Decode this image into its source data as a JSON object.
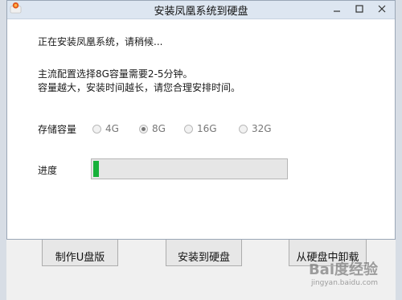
{
  "window": {
    "title": "安装凤凰系统到硬盘",
    "minimize_icon": "minimize-icon",
    "maximize_icon": "maximize-icon",
    "close_icon": "close-icon"
  },
  "messages": {
    "line1": "正在安装凤凰系统，请稍候...",
    "line2": "主流配置选择8G容量需要2-5分钟。",
    "line3": "容量越大，安装时间越长，请您合理安排时间。"
  },
  "capacity": {
    "label": "存储容量",
    "options": [
      "4G",
      "8G",
      "16G",
      "32G"
    ],
    "selected": "8G"
  },
  "progress": {
    "label": "进度",
    "value_fraction": 0.03,
    "fill_color": "#17b13a"
  },
  "background_buttons": {
    "make_usb": "制作U盘版",
    "install_disk": "安装到硬盘",
    "uninstall": "从硬盘中卸载"
  },
  "watermark": {
    "text": "Bai度经验",
    "sub": "jingyan.baidu.com"
  }
}
